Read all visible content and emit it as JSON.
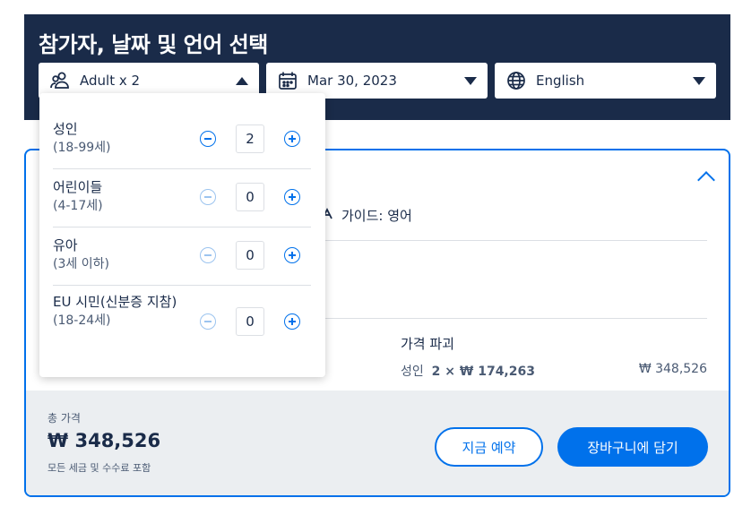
{
  "header": {
    "title": "참가자, 날짜 및 언어 선택",
    "participants_label": "Adult x 2",
    "date_label": "Mar 30, 2023",
    "language_label": "English"
  },
  "card": {
    "guide_text": "가이드: 영어",
    "price_breakdown_label": "가격 파괴",
    "partial_left_char": "",
    "price_line_adult": "성인",
    "price_line_qty": "2 × ₩ 174,263",
    "price_line_total": "₩ 348,526"
  },
  "footer": {
    "total_label": "총 가격",
    "total_amount": "₩ 348,526",
    "total_note": "모든 세금 및 수수료 포함",
    "book_now": "지금 예약",
    "add_to_cart": "장바구니에 담기"
  },
  "participants": [
    {
      "label": "성인",
      "age": "(18-99세)",
      "count": "2",
      "minus_enabled": true
    },
    {
      "label": "어린이들",
      "age": "(4-17세)",
      "count": "0",
      "minus_enabled": false
    },
    {
      "label": "유아",
      "age": "(3세 이하)",
      "count": "0",
      "minus_enabled": false
    },
    {
      "label": "EU 시민(신분증 지참)",
      "age": "(18-24세)",
      "count": "0",
      "minus_enabled": false
    }
  ],
  "colors": {
    "navy": "#1a2b49",
    "accent": "#0071eb",
    "footer_bg": "#ebeef1"
  }
}
